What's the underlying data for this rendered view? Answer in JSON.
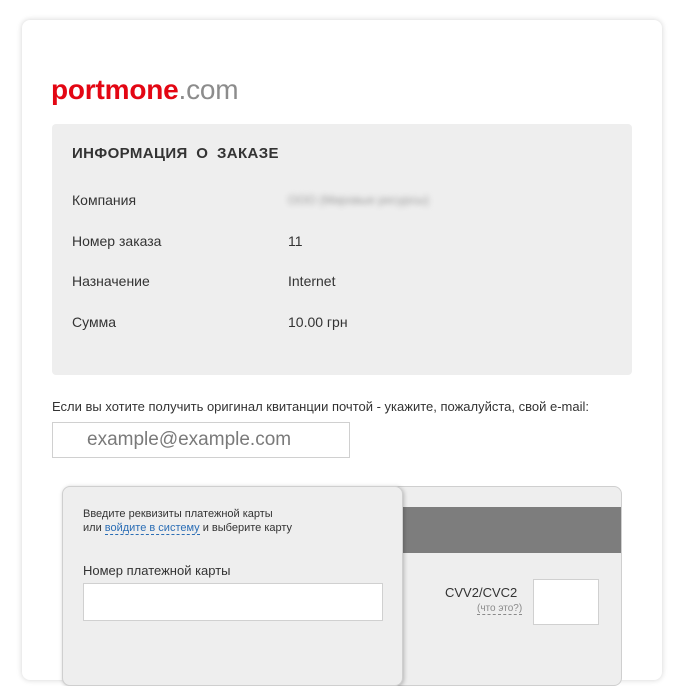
{
  "logo": {
    "brand": "portmone",
    "tld": ".com"
  },
  "order_info": {
    "title": "ИНФОРМАЦИЯ  О  ЗАКАЗЕ",
    "rows": [
      {
        "label": "Компания",
        "value": "ООО (Мировые ресурсы)"
      },
      {
        "label": "Номер заказа",
        "value": "11"
      },
      {
        "label": "Назначение",
        "value": "Internet"
      },
      {
        "label": "Сумма",
        "value": "10.00 грн"
      }
    ]
  },
  "email": {
    "note": "Если вы хотите получить оригинал квитанции почтой - укажите, пожалуйста, свой e-mail:",
    "placeholder": "example@example.com",
    "value": ""
  },
  "payment": {
    "front_line1": "Введите реквизиты платежной карты",
    "front_line2_prefix": "или ",
    "login_link": "войдите в систему",
    "front_line2_suffix": " и выберите карту",
    "card_number_label": "Номер платежной карты",
    "card_number_value": "",
    "cvv_label": "CVV2/CVC2",
    "cvv_hint": "(что это?)",
    "cvv_value": ""
  },
  "colors": {
    "brand_red": "#e30613",
    "link_blue": "#2a6db5",
    "panel_gray": "#eeeeee",
    "stripe_gray": "#7d7d7d"
  }
}
